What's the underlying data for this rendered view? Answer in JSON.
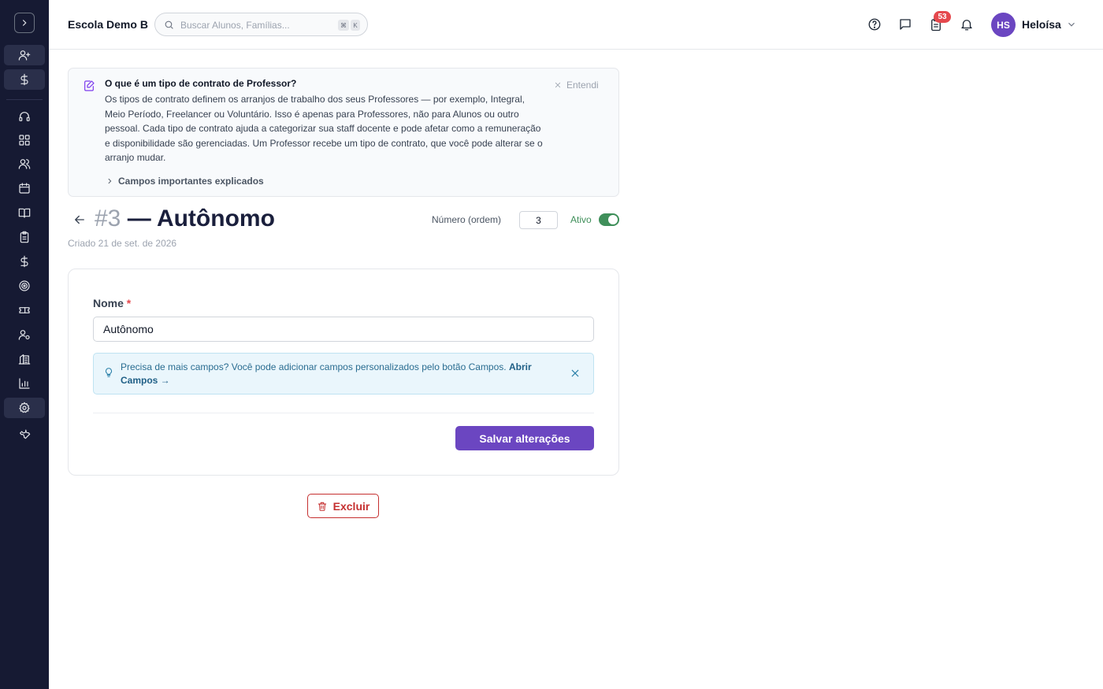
{
  "header": {
    "school_name": "Escola Demo B",
    "search_placeholder": "Buscar Alunos, Famílias...",
    "search_kbd": [
      "⌘",
      "K"
    ],
    "notification_count": "53",
    "user_initials": "HS",
    "user_name": "Heloísa"
  },
  "sidebar": {
    "icons": [
      "chevron-right-icon",
      "user-plus-icon",
      "dollar-icon",
      "headset-icon",
      "dashboard-icon",
      "users-icon",
      "calendar-icon",
      "book-icon",
      "clipboard-icon",
      "dollar-icon",
      "target-icon",
      "ticket-icon",
      "user-settings-icon",
      "building-icon",
      "bar-chart-icon",
      "gear-icon",
      "wrench-icon"
    ],
    "active": "gear-icon"
  },
  "info": {
    "title": "O que é um tipo de contrato de Professor?",
    "text": "Os tipos de contrato definem os arranjos de trabalho dos seus Professores — por exemplo, Integral, Meio Período, Freelancer ou Voluntário. Isso é apenas para Professores, não para Alunos ou outro pessoal. Cada tipo de contrato ajuda a categorizar sua staff docente e pode afetar como a remuneração e disponibilidade são gerenciadas. Um Professor recebe um tipo de contrato, que você pode alterar se o arranjo mudar.",
    "dismiss_label": "Entendi",
    "fields_toggle_label": "Campos importantes explicados"
  },
  "record": {
    "number": "#3",
    "title": "— Autônomo",
    "created": "Criado 21 de set. de 2026",
    "order_label": "Número (ordem)",
    "order_value": "3",
    "active_label": "Ativo",
    "active": true
  },
  "form": {
    "name_label": "Nome",
    "required_mark": "*",
    "name_value": "Autônomo",
    "tip_text": "Precisa de mais campos? Você pode adicionar campos personalizados pelo botão Campos.",
    "tip_link": "Abrir Campos →",
    "save_label": "Salvar alterações",
    "delete_label": "Excluir"
  },
  "colors": {
    "sidebar_bg": "#161a33",
    "accent": "#6b46c1",
    "danger": "#c53030",
    "active_green": "#3f8f5a"
  }
}
